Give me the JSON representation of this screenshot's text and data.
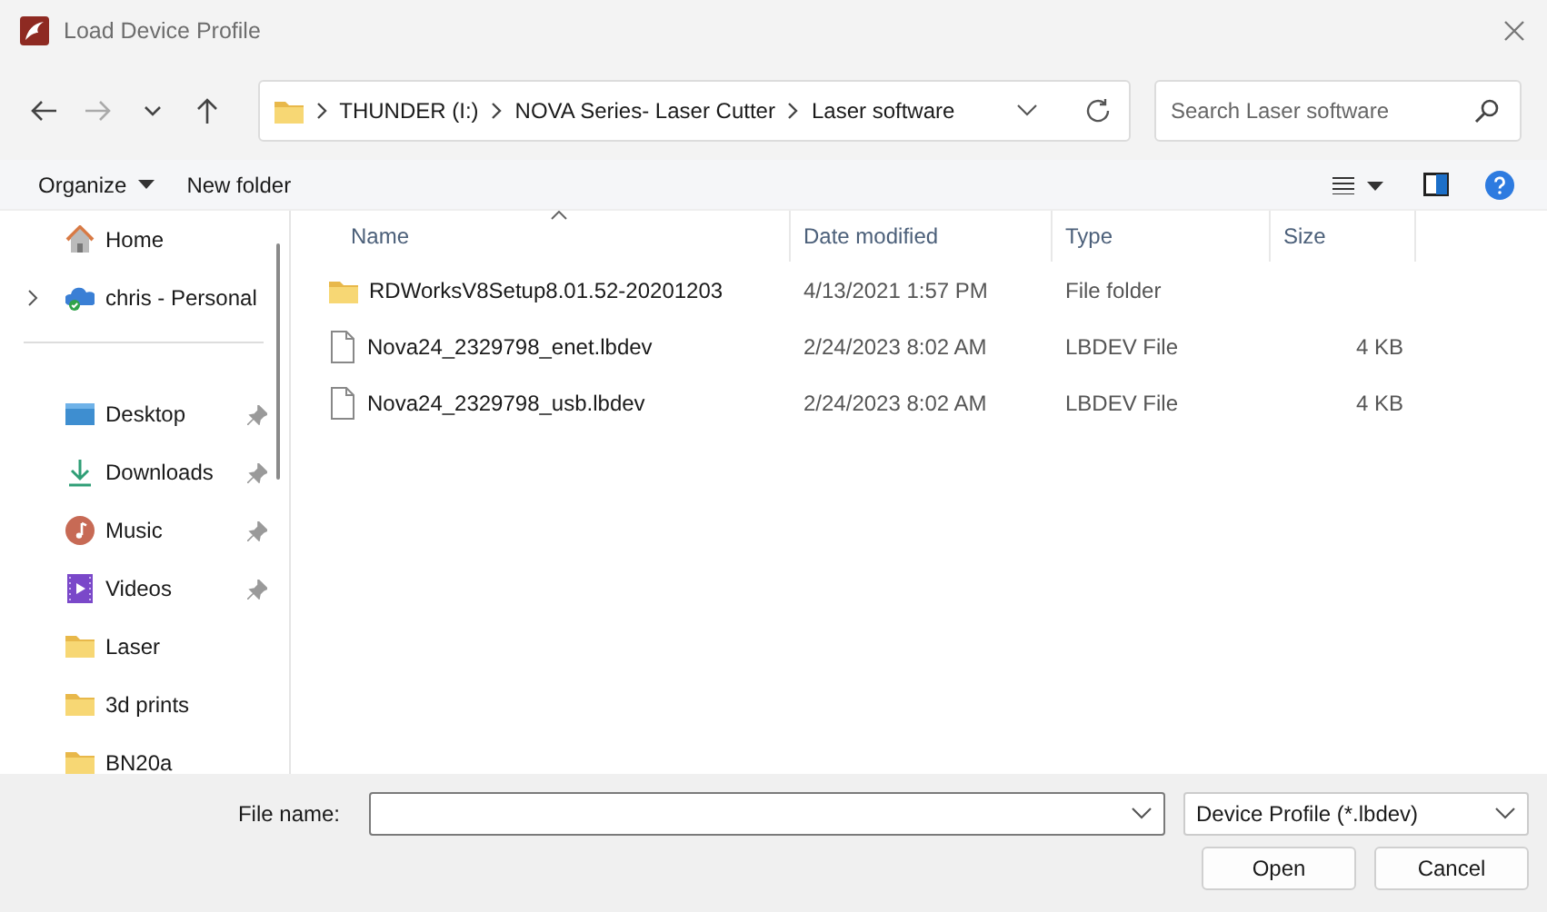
{
  "window": {
    "title": "Load Device Profile"
  },
  "navigation": {
    "buttons": [
      {
        "kind": "back",
        "disabled": false
      },
      {
        "kind": "forward",
        "disabled": true
      },
      {
        "kind": "recent",
        "disabled": false
      },
      {
        "kind": "up",
        "disabled": false
      }
    ],
    "breadcrumb": [
      "THUNDER (I:)",
      "NOVA Series- Laser Cutter",
      "Laser software"
    ],
    "search": {
      "placeholder": "Search Laser software"
    }
  },
  "toolbar": {
    "organize": "Organize",
    "new_folder": "New folder"
  },
  "sidebar": {
    "groups": [
      [
        {
          "label": "Home",
          "pinned": false
        },
        {
          "label": "chris - Personal",
          "pinned": false,
          "expanded": false
        }
      ],
      [
        {
          "label": "Desktop",
          "pinned": true
        },
        {
          "label": "Downloads",
          "pinned": true
        },
        {
          "label": "Music",
          "pinned": true
        },
        {
          "label": "Videos",
          "pinned": true
        },
        {
          "label": "Laser",
          "pinned": false
        },
        {
          "label": "3d prints",
          "pinned": false
        },
        {
          "label": "BN20a",
          "pinned": false
        }
      ]
    ]
  },
  "table": {
    "columns": [
      {
        "label": "Name",
        "sorted": true
      },
      {
        "label": "Date modified",
        "sorted": false
      },
      {
        "label": "Type",
        "sorted": false
      },
      {
        "label": "Size",
        "sorted": false
      }
    ],
    "rows": [
      {
        "kind": "folder",
        "name": "RDWorksV8Setup8.01.52-20201203",
        "date": "4/13/2021 1:57 PM",
        "type": "File folder"
      },
      {
        "kind": "file",
        "name": "Nova24_2329798_enet.lbdev",
        "date": "2/24/2023 8:02 AM",
        "type": "LBDEV File",
        "size": "4 KB"
      },
      {
        "kind": "file",
        "name": "Nova24_2329798_usb.lbdev",
        "date": "2/24/2023 8:02 AM",
        "type": "LBDEV File",
        "size": "4 KB"
      }
    ]
  },
  "footer": {
    "file_name_label": "File name:",
    "file_type": "Device Profile (*.lbdev)",
    "buttons": [
      "Open",
      "Cancel"
    ]
  }
}
